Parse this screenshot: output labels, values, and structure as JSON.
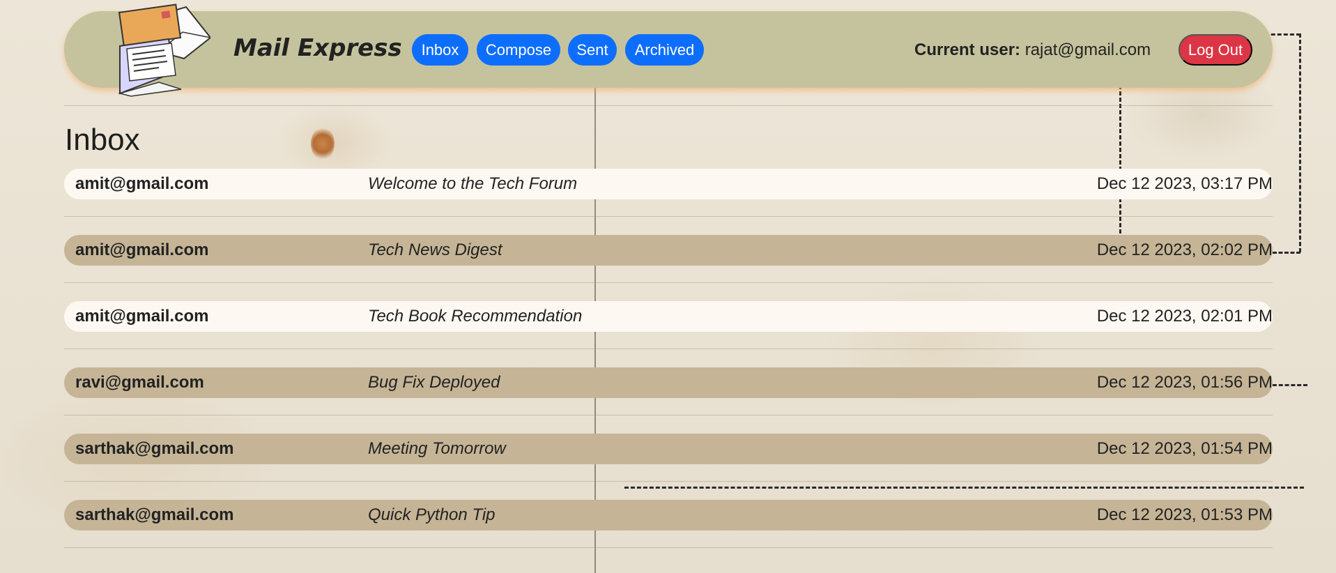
{
  "app": {
    "title": "Mail Express",
    "nav": [
      {
        "label": "Inbox"
      },
      {
        "label": "Compose"
      },
      {
        "label": "Sent"
      },
      {
        "label": "Archived"
      }
    ],
    "current_user_label": "Current user:",
    "current_user_email": "rajat@gmail.com",
    "logout_label": "Log Out",
    "colors": {
      "header_bg": "#c5c39d",
      "primary_button": "#0d6efd",
      "danger_button": "#dc3545",
      "read_row": "#fdf8f2",
      "unread_row": "#c5b596"
    }
  },
  "page": {
    "title": "Inbox"
  },
  "emails": [
    {
      "sender": "amit@gmail.com",
      "subject": "Welcome to the Tech Forum",
      "timestamp": "Dec 12 2023, 03:17 PM",
      "read": true
    },
    {
      "sender": "amit@gmail.com",
      "subject": "Tech News Digest",
      "timestamp": "Dec 12 2023, 02:02 PM",
      "read": false
    },
    {
      "sender": "amit@gmail.com",
      "subject": "Tech Book Recommendation",
      "timestamp": "Dec 12 2023, 02:01 PM",
      "read": true
    },
    {
      "sender": "ravi@gmail.com",
      "subject": "Bug Fix Deployed",
      "timestamp": "Dec 12 2023, 01:56 PM",
      "read": false
    },
    {
      "sender": "sarthak@gmail.com",
      "subject": "Meeting Tomorrow",
      "timestamp": "Dec 12 2023, 01:54 PM",
      "read": false
    },
    {
      "sender": "sarthak@gmail.com",
      "subject": "Quick Python Tip",
      "timestamp": "Dec 12 2023, 01:53 PM",
      "read": false
    }
  ]
}
